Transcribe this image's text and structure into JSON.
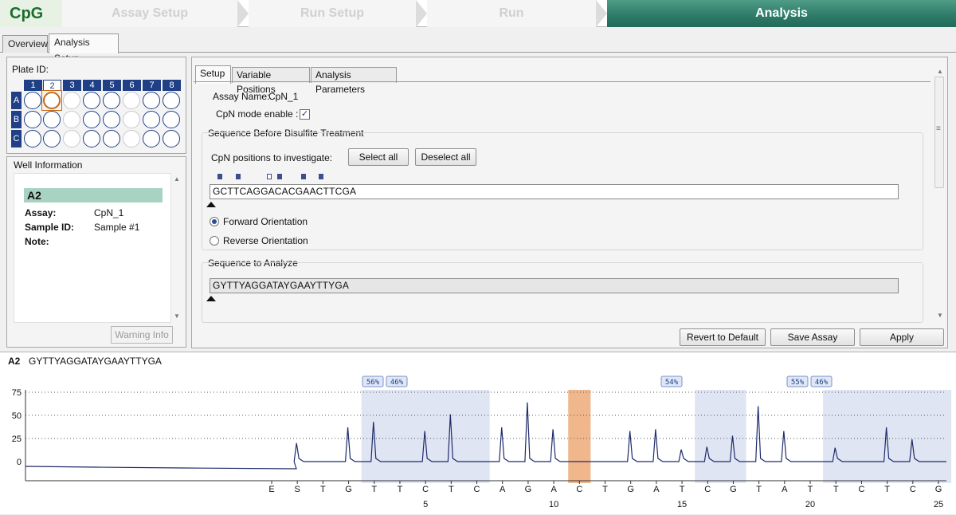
{
  "app": {
    "title": "CpG"
  },
  "wizard": {
    "steps": [
      {
        "label": "Assay Setup"
      },
      {
        "label": "Run Setup"
      },
      {
        "label": "Run"
      },
      {
        "label": "Analysis"
      }
    ]
  },
  "outer_tabs": [
    "Overview",
    "Analysis Setup"
  ],
  "plate": {
    "label": "Plate ID:",
    "columns": [
      "1",
      "2",
      "3",
      "4",
      "5",
      "6",
      "7",
      "8"
    ],
    "rows": [
      "A",
      "B",
      "C"
    ],
    "selected_well": "A2",
    "empty_column": "3 and 6"
  },
  "well_info": {
    "legend": "Well Information",
    "id": "A2",
    "assay_label": "Assay:",
    "assay_value": "CpN_1",
    "sample_label": "Sample ID:",
    "sample_value": "Sample #1",
    "note_label": "Note:",
    "warning_button": "Warning Info"
  },
  "setup": {
    "tabs": [
      "Setup",
      "Variable Positions",
      "Analysis Parameters"
    ],
    "assay_name_label": "Assay Name:",
    "assay_name_value": "CpN_1",
    "cpn_mode_label": "CpN mode enable :",
    "cpn_mode_checked": "✓",
    "before_title": "Sequence Before Bisulfite Treatment",
    "positions_label": "CpN positions to investigate:",
    "select_all": "Select all",
    "deselect_all": "Deselect all",
    "sequence_before": "GCTTCAGGACACGAACTTCGA",
    "forward_label": "Forward Orientation",
    "reverse_label": "Reverse Orientation",
    "orientation_selected": "Forward Orientation",
    "analyze_title": "Sequence to Analyze",
    "sequence_analyze": "GYTTYAGGATAYGAAYTTYGA"
  },
  "actions": {
    "revert": "Revert to Default",
    "save": "Save Assay",
    "apply": "Apply"
  },
  "pyrogram": {
    "well": "A2",
    "sequence": "GYTTYAGGATAYGAAYTTYGA",
    "colors": {
      "trace": "#1f2b6b",
      "highlight": "#dfe5f2",
      "warning": "#f0b78c"
    },
    "badges": [
      "56%",
      "46%",
      "54%",
      "55%",
      "46%"
    ],
    "chart_data": {
      "type": "line",
      "ylim": [
        0,
        75
      ],
      "yticks": [
        "0",
        "25",
        "50",
        "75"
      ],
      "dispensations": [
        "E",
        "S",
        "T",
        "G",
        "T",
        "T",
        "C",
        "T",
        "C",
        "A",
        "G",
        "A",
        "C",
        "T",
        "G",
        "A",
        "T",
        "C",
        "G",
        "T",
        "A",
        "T",
        "T",
        "C",
        "T",
        "C",
        "G"
      ],
      "x_tick_labels": [
        "5",
        "10",
        "15",
        "20",
        "25"
      ],
      "peaks": [
        20,
        37,
        43,
        33,
        51,
        37,
        64,
        35,
        0,
        33,
        35,
        13,
        16,
        28,
        60,
        33,
        15,
        37,
        24
      ],
      "highlighted_regions": [
        {
          "from": "T",
          "to": "C",
          "percentages": [
            "56%",
            "46%"
          ]
        },
        {
          "from": "T",
          "to": "C",
          "percentages": [
            "54%"
          ]
        },
        {
          "from": "T",
          "to": "C",
          "percentages": [
            "55%",
            "46%"
          ]
        }
      ],
      "warning_region": "C"
    }
  }
}
